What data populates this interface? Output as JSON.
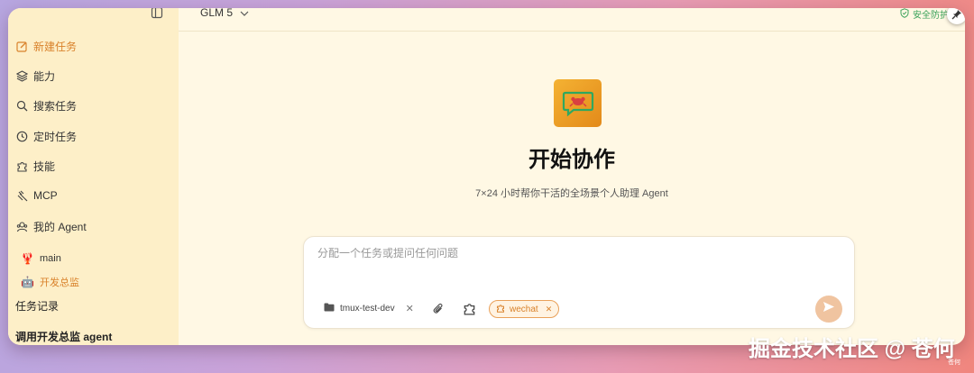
{
  "sidebar": {
    "items": [
      {
        "label": "新建任务",
        "icon": "edit-icon",
        "active": true
      },
      {
        "label": "能力",
        "icon": "layers-icon"
      },
      {
        "label": "搜索任务",
        "icon": "search-icon"
      },
      {
        "label": "定时任务",
        "icon": "clock-icon"
      },
      {
        "label": "技能",
        "icon": "puzzle-icon"
      },
      {
        "label": "MCP",
        "icon": "plug-icon"
      },
      {
        "label": "我的 Agent",
        "icon": "agent-icon"
      }
    ],
    "agents": [
      {
        "label": "main",
        "icon": "lobster-icon"
      },
      {
        "label": "开发总监",
        "icon": "robot-icon",
        "active": true
      }
    ],
    "history_label": "任务记录",
    "recent_task": "调用开发总监 agent"
  },
  "header": {
    "model": "GLM 5",
    "security": "安全防护"
  },
  "main": {
    "title": "开始协作",
    "subtitle": "7×24 小时帮你干活的全场景个人助理 Agent"
  },
  "composer": {
    "placeholder": "分配一个任务或提问任何问题",
    "folder": "tmux-test-dev",
    "skill_chip": "wechat"
  },
  "watermark": {
    "text": "掘金技术社区 @ 苍何",
    "small": "苍何"
  },
  "colors": {
    "accent": "#d9822b",
    "sidebar_bg": "#fdefc8",
    "main_bg": "#fff8e4",
    "send_button": "#f0c4a0"
  }
}
